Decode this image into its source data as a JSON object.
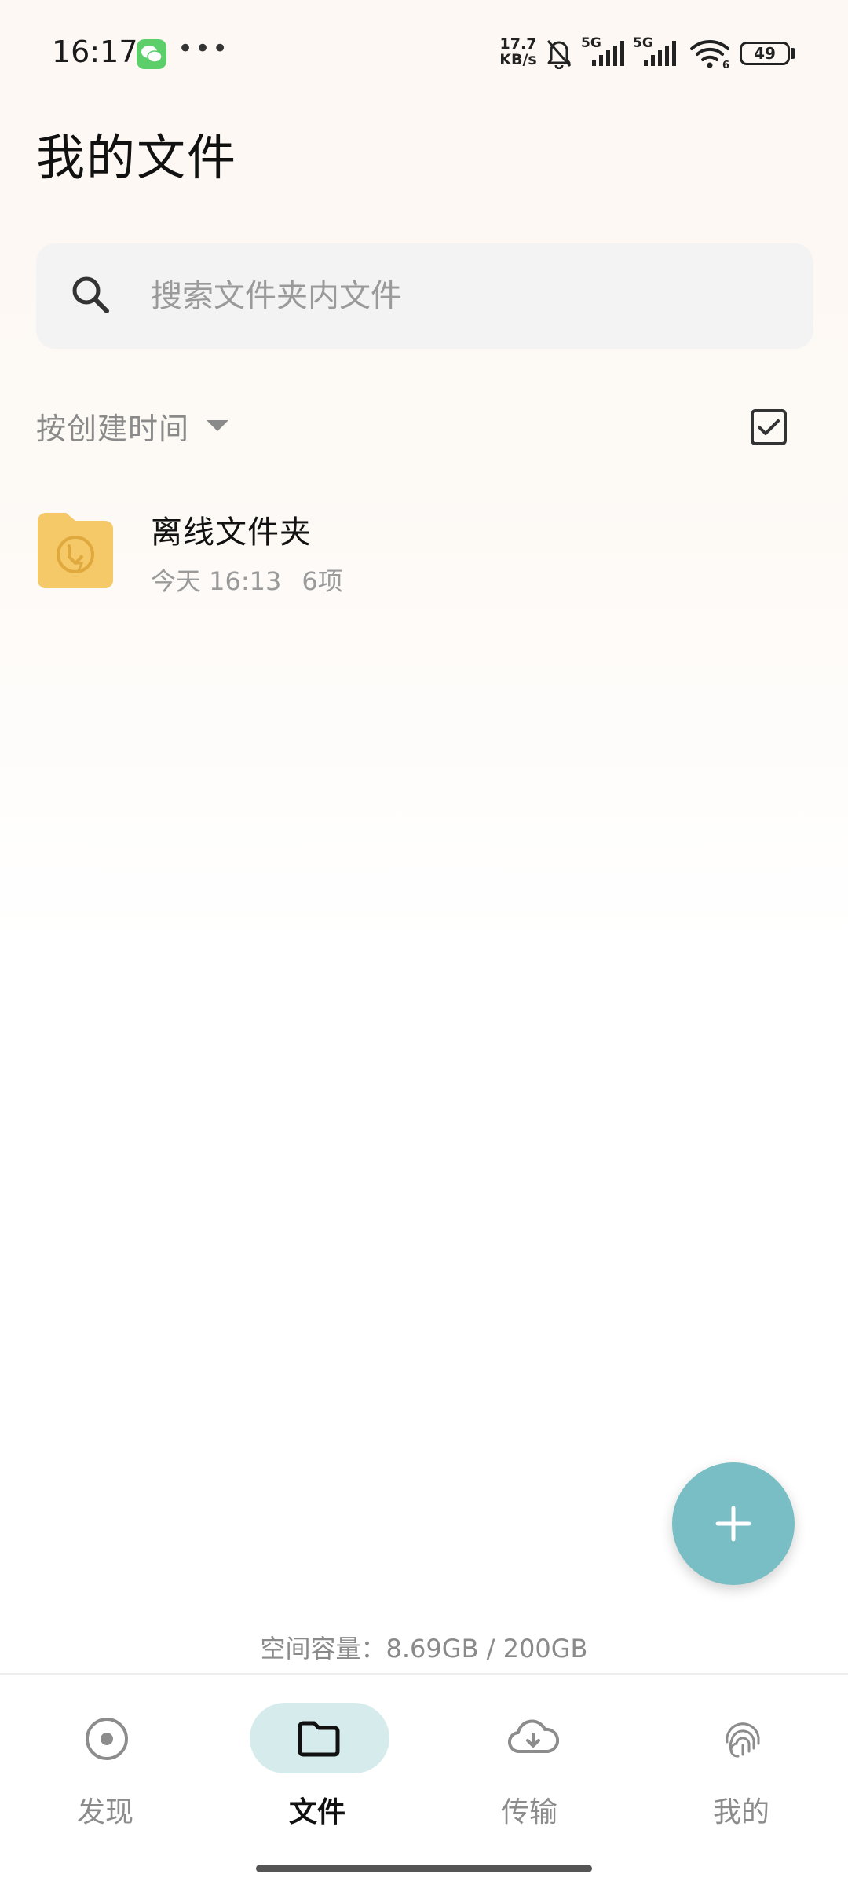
{
  "status_bar": {
    "time": "16:17",
    "net_speed_value": "17.7",
    "net_speed_unit": "KB/s",
    "signal_1_label": "5G",
    "signal_2_label": "5G",
    "wifi_badge": "6",
    "battery": "49",
    "icons": [
      "wechat-icon",
      "more-icon",
      "bell-off-icon",
      "signal-icon",
      "wifi-icon",
      "battery-icon"
    ]
  },
  "header": {
    "title": "我的文件"
  },
  "search": {
    "placeholder": "搜索文件夹内文件",
    "value": ""
  },
  "sort": {
    "label": "按创建时间"
  },
  "files": [
    {
      "name": "离线文件夹",
      "date": "今天 16:13",
      "count": "6项",
      "icon": "offline-folder-icon"
    }
  ],
  "storage": {
    "text": "空间容量：8.69GB / 200GB"
  },
  "bottom_nav": {
    "items": [
      {
        "label": "发现",
        "icon": "discover-icon",
        "active": false
      },
      {
        "label": "文件",
        "icon": "folder-icon",
        "active": true
      },
      {
        "label": "传输",
        "icon": "cloud-download-icon",
        "active": false
      },
      {
        "label": "我的",
        "icon": "fingerprint-icon",
        "active": false
      }
    ]
  },
  "colors": {
    "accent": "#78bec4",
    "active_pill": "#d6ecec",
    "folder": "#f5c868"
  }
}
